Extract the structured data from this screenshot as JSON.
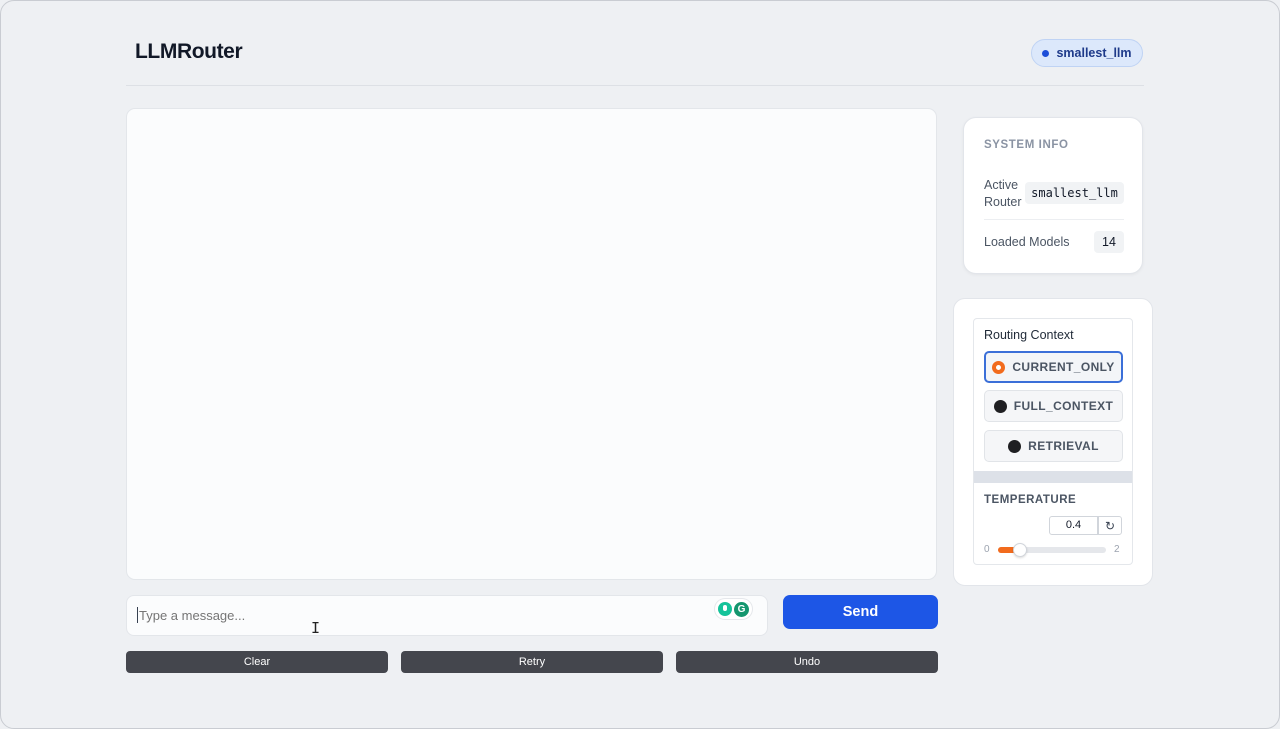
{
  "header": {
    "title": "LLMRouter",
    "router_badge": "smallest_llm"
  },
  "chat": {
    "input_placeholder": "Type a message...",
    "send_label": "Send"
  },
  "actions": {
    "clear": "Clear",
    "retry": "Retry",
    "undo": "Undo"
  },
  "system_info": {
    "title": "SYSTEM INFO",
    "active_router_label": "Active Router",
    "active_router_value": "smallest_llm",
    "loaded_models_label": "Loaded Models",
    "loaded_models_value": "14"
  },
  "routing": {
    "label": "Routing Context",
    "options": [
      "CURRENT_ONLY",
      "FULL_CONTEXT",
      "RETRIEVAL"
    ],
    "selected": "CURRENT_ONLY"
  },
  "temperature": {
    "label": "TEMPERATURE",
    "value": "0.4",
    "min": "0",
    "max": "2",
    "level": 0.2
  },
  "colors": {
    "accent": "#1d56e6",
    "slider": "#f26b1d",
    "badge_bg": "#dce8fb"
  },
  "icons": {
    "reset": "refresh-icon",
    "grammarly": "grammarly-icon",
    "cursor": "text-cursor-icon"
  }
}
